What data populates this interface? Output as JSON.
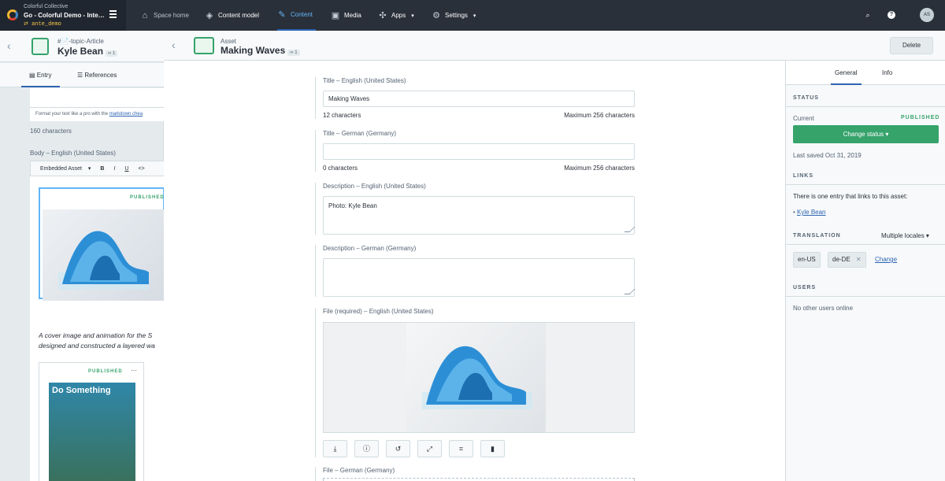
{
  "topbar": {
    "org_name": "Colorful Collective",
    "space_name": "Go - Colorful Demo - Inte…",
    "environment": "ante_demo",
    "nav": [
      "Space home",
      "Content model",
      "Content",
      "Media",
      "Apps",
      "Settings"
    ],
    "avatar_initials": "AS"
  },
  "entry": {
    "content_type": "#📄-topic-Article",
    "title": "Kyle Bean",
    "version": "1",
    "tabs": [
      "Entry",
      "References"
    ],
    "format_hint": "Format your text like a pro with the",
    "format_link": "markdown chea",
    "char_count": "160 characters",
    "body_label": "Body – English (United States)",
    "toolbar": {
      "embed": "Embedded Asset",
      "bold": "B",
      "italic": "I",
      "underline": "U",
      "code": "<>"
    },
    "embed_status": "PUBLISHED",
    "caption_line1": "A cover image and animation for the S",
    "caption_line2": "designed and constructed a layered wa",
    "embed2_status": "PUBLISHED",
    "embed2_menu": "···",
    "magazine_title": "Do Something"
  },
  "asset": {
    "type": "Asset",
    "title": "Making Waves",
    "version": "1",
    "delete_label": "Delete",
    "fields": {
      "title_en_label": "Title – English (United States)",
      "title_en_value": "Making Waves",
      "title_en_count": "12 characters",
      "title_de_label": "Title – German (Germany)",
      "title_de_value": "",
      "title_de_count": "0 characters",
      "max_chars": "Maximum 256 characters",
      "desc_en_label": "Description – English (United States)",
      "desc_en_value": "Photo: Kyle Bean",
      "desc_de_label": "Description – German (Germany)",
      "desc_de_value": "",
      "file_en_label": "File (required) – English (United States)",
      "file_de_label": "File – German (Germany)"
    },
    "file_actions": [
      "download-icon",
      "info-icon",
      "replace-icon",
      "resize-icon",
      "crop-icon",
      "trash-icon"
    ]
  },
  "sidebar": {
    "tabs": [
      "General",
      "Info"
    ],
    "status_heading": "STATUS",
    "current_label": "Current",
    "current_value": "PUBLISHED",
    "change_status": "Change status",
    "last_saved": "Last saved Oct 31, 2019",
    "links_heading": "LINKS",
    "links_text": "There is one entry that links to this asset:",
    "link_entry": "Kyle Bean",
    "translation_heading": "TRANSLATION",
    "translation_mode": "Multiple locales",
    "locales": [
      "en-US",
      "de-DE"
    ],
    "locale_change": "Change",
    "users_heading": "USERS",
    "users_text": "No other users online"
  },
  "colors": {
    "topbar": "#2a3039",
    "accent": "#2d64b3",
    "positive": "#36a36b"
  }
}
